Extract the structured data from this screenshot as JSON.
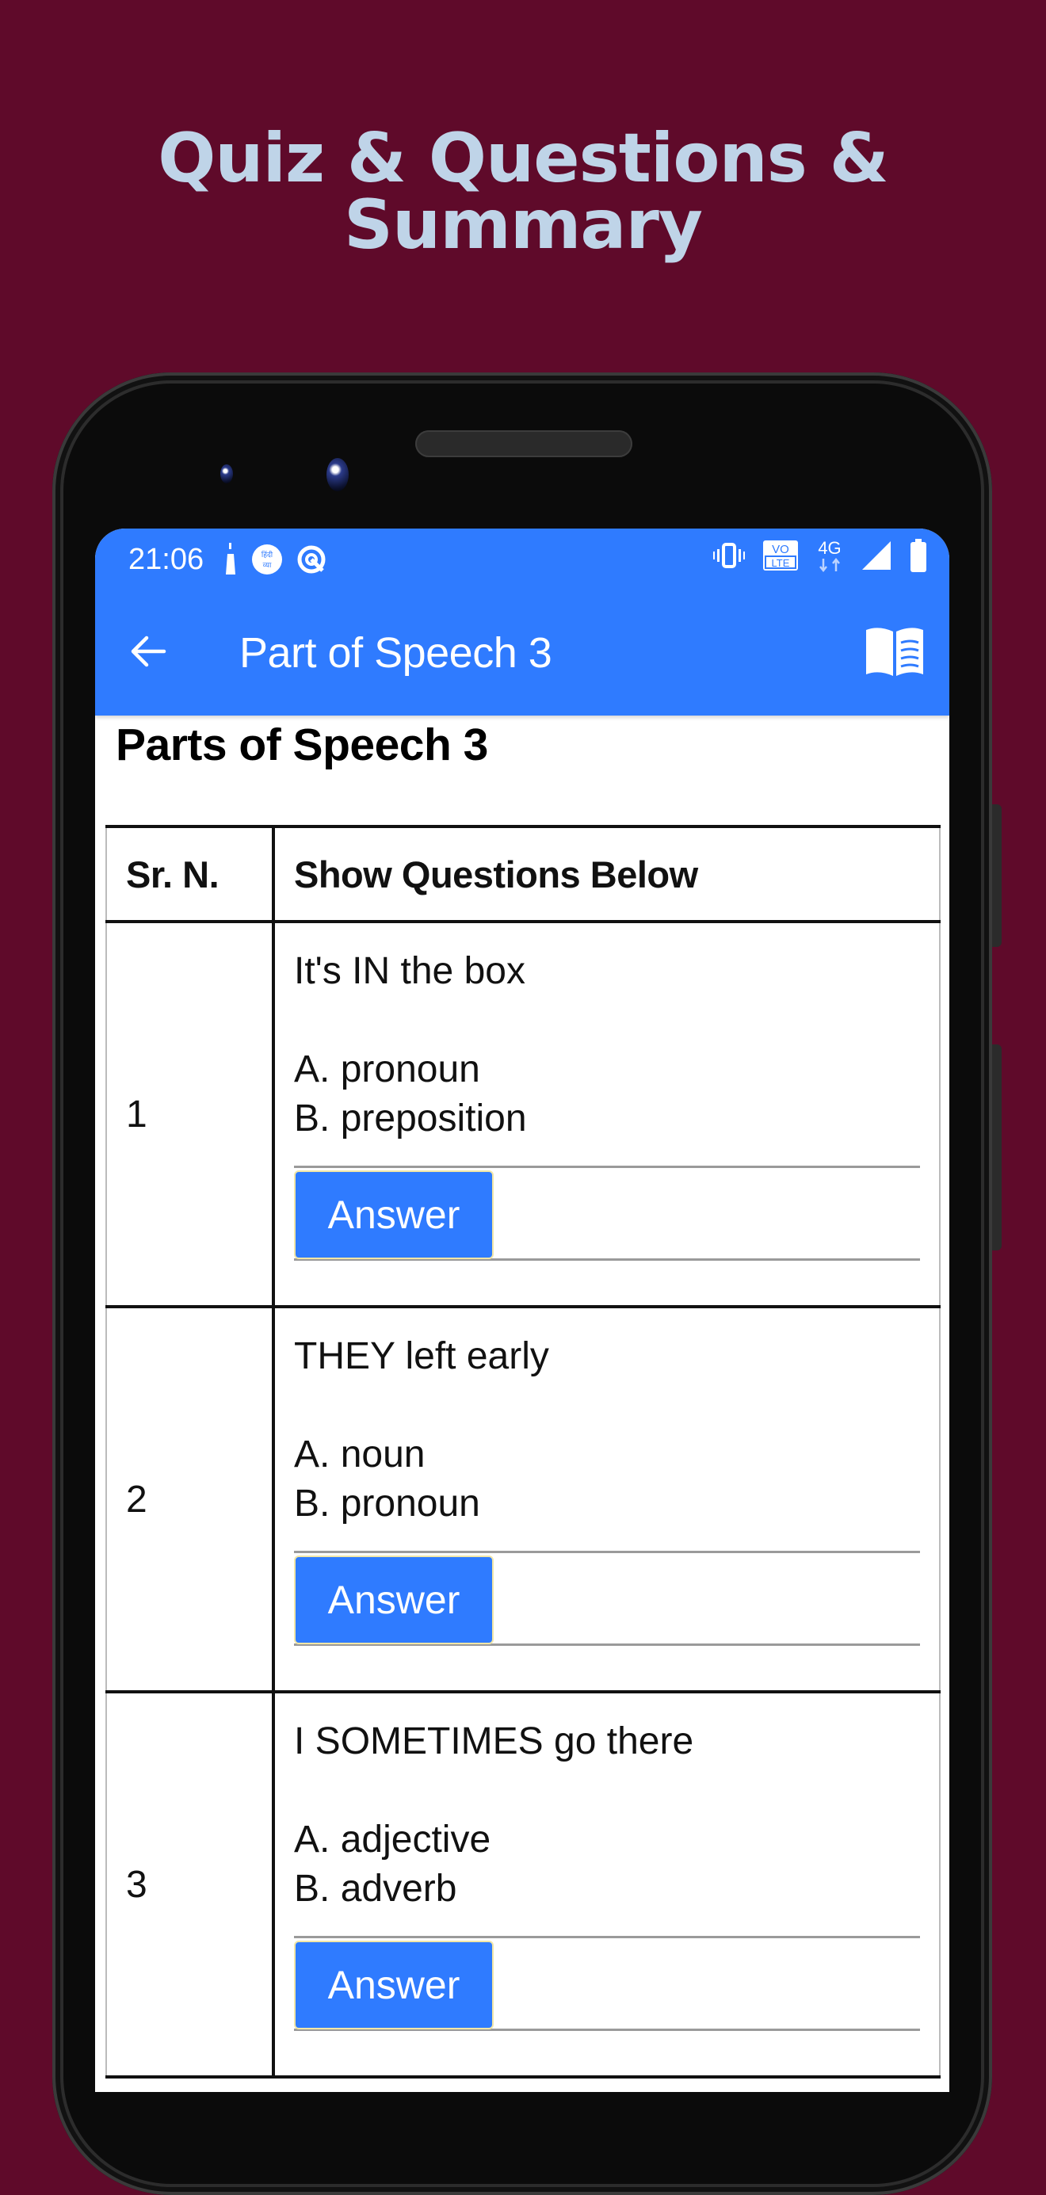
{
  "promo": {
    "headline_line1": "Quiz & Questions &",
    "headline_line2": "Summary",
    "background_color": "#5F0A2A",
    "headline_color": "#BFD4E8"
  },
  "status_bar": {
    "time": "21:06",
    "left_icons": [
      "notification-pin-icon",
      "app-badge-icon",
      "sync-icon"
    ],
    "right_icons": [
      "vibrate-icon",
      "volte-icon",
      "network-4g-icon",
      "signal-icon",
      "battery-icon"
    ],
    "volte_label_top": "VO",
    "volte_label_bottom": "LTE",
    "network_label": "4G"
  },
  "toolbar": {
    "title": "Part of Speech 3",
    "back_icon": "arrow-left-icon",
    "action_icon": "book-icon",
    "color": "#2F7BFF"
  },
  "page": {
    "heading": "Parts of Speech 3"
  },
  "table": {
    "headers": [
      "Sr. N.",
      "Show Questions Below"
    ],
    "rows": [
      {
        "sr": "1",
        "question": "It's IN the box",
        "option_a": "A. pronoun",
        "option_b": "B. preposition",
        "button_label": "Answer"
      },
      {
        "sr": "2",
        "question": "THEY left early",
        "option_a": "A. noun",
        "option_b": "B. pronoun",
        "button_label": "Answer"
      },
      {
        "sr": "3",
        "question": "I SOMETIMES go there",
        "option_a": "A. adjective",
        "option_b": "B. adverb",
        "button_label": "Answer"
      }
    ]
  }
}
